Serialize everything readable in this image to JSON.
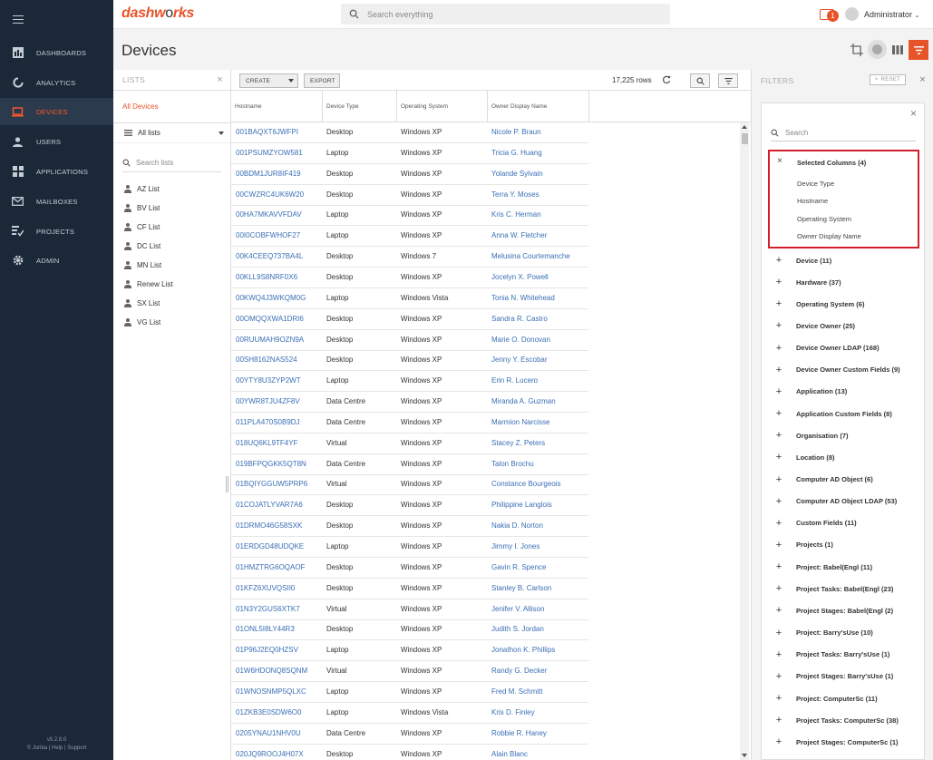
{
  "app": {
    "logo_main": "dashw",
    "logo_o": "o",
    "logo_rest": "rks"
  },
  "search": {
    "placeholder": "Search everything"
  },
  "notifications": {
    "count": "1"
  },
  "user": {
    "name": "Administrator"
  },
  "nav": {
    "items": [
      {
        "label": "DASHBOARDS",
        "icon": "dashboard-icon"
      },
      {
        "label": "ANALYTICS",
        "icon": "analytics-icon"
      },
      {
        "label": "DEVICES",
        "icon": "laptop-icon",
        "active": true
      },
      {
        "label": "USERS",
        "icon": "user-icon"
      },
      {
        "label": "APPLICATIONS",
        "icon": "applications-icon"
      },
      {
        "label": "MAILBOXES",
        "icon": "mail-icon"
      },
      {
        "label": "PROJECTS",
        "icon": "projects-icon"
      },
      {
        "label": "ADMIN",
        "icon": "gear-icon"
      }
    ],
    "version": "v5.2.8.0",
    "footer": "© Juriba | Help | Support"
  },
  "page": {
    "title": "Devices"
  },
  "lists": {
    "title": "LISTS",
    "all_devices": "All Devices",
    "all_lists": "All lists",
    "search_placeholder": "Search lists",
    "items": [
      "AZ List",
      "BV List",
      "CF List",
      "DC List",
      "MN List",
      "Renew List",
      "SX List",
      "VG List"
    ]
  },
  "grid": {
    "create_label": "CREATE",
    "export_label": "EXPORT",
    "rows_count": "17,225 rows",
    "columns": [
      "Hostname",
      "Device Type",
      "Operating System",
      "Owner Display Name"
    ],
    "rows": [
      [
        "001BAQXT6JWFPI",
        "Desktop",
        "Windows XP",
        "Nicole P. Braun"
      ],
      [
        "001PSUMZYOW581",
        "Laptop",
        "Windows XP",
        "Tricia G. Huang"
      ],
      [
        "00BDM1JUR8IF419",
        "Desktop",
        "Windows XP",
        "Yolande Sylvain"
      ],
      [
        "00CWZRC4UK6W20",
        "Desktop",
        "Windows XP",
        "Terra Y. Moses"
      ],
      [
        "00HA7MKAVVFDAV",
        "Laptop",
        "Windows XP",
        "Kris C. Herman"
      ],
      [
        "00I0COBFWHOF27",
        "Laptop",
        "Windows XP",
        "Anna W. Fletcher"
      ],
      [
        "00K4CEEQ737BA4L",
        "Desktop",
        "Windows 7",
        "Melusina Courtemanche"
      ],
      [
        "00KLL9S8NRF0X6",
        "Desktop",
        "Windows XP",
        "Jocelyn X. Powell"
      ],
      [
        "00KWQ4J3WKQM0G",
        "Laptop",
        "Windows Vista",
        "Tonia N. Whitehead"
      ],
      [
        "00OMQQXWA1DRI6",
        "Desktop",
        "Windows XP",
        "Sandra R. Castro"
      ],
      [
        "00RUUMAH9OZN9A",
        "Desktop",
        "Windows XP",
        "Marie O. Donovan"
      ],
      [
        "00SH8162NAS524",
        "Desktop",
        "Windows XP",
        "Jenny Y. Escobar"
      ],
      [
        "00YTY8U3ZYP2WT",
        "Laptop",
        "Windows XP",
        "Erin R. Lucero"
      ],
      [
        "00YWR8TJU4ZF8V",
        "Data Centre",
        "Windows XP",
        "Miranda A. Guzman"
      ],
      [
        "011PLA470S0B9DJ",
        "Data Centre",
        "Windows XP",
        "Marmion Narcisse"
      ],
      [
        "018UQ6KL9TF4YF",
        "Virtual",
        "Windows XP",
        "Stacey Z. Peters"
      ],
      [
        "019BFPQGKK5QT8N",
        "Data Centre",
        "Windows XP",
        "Talon Brochu"
      ],
      [
        "01BQIYGGUW5PRP6",
        "Virtual",
        "Windows XP",
        "Constance Bourgeois"
      ],
      [
        "01COJATLYVAR7A6",
        "Desktop",
        "Windows XP",
        "Philippine Langlois"
      ],
      [
        "01DRMO46G58SXK",
        "Desktop",
        "Windows XP",
        "Nakia D. Norton"
      ],
      [
        "01ERDGD48UDQKE",
        "Laptop",
        "Windows XP",
        "Jimmy I. Jones"
      ],
      [
        "01HMZTRG6OQAOF",
        "Desktop",
        "Windows XP",
        "Gavin R. Spence"
      ],
      [
        "01KFZ6XUVQSII0",
        "Desktop",
        "Windows XP",
        "Stanley B. Carlson"
      ],
      [
        "01N3Y2GUS6XTK7",
        "Virtual",
        "Windows XP",
        "Jenifer V. Allison"
      ],
      [
        "01ONL5I8LY44R3",
        "Desktop",
        "Windows XP",
        "Judith S. Jordan"
      ],
      [
        "01P96J2EQ0HZSV",
        "Laptop",
        "Windows XP",
        "Jonathon K. Phillips"
      ],
      [
        "01W6HDONQ8SQNM",
        "Virtual",
        "Windows XP",
        "Randy G. Decker"
      ],
      [
        "01WNOSNMP5QLXC",
        "Laptop",
        "Windows XP",
        "Fred M. Schmitt"
      ],
      [
        "01ZKB3E0SDW6O0",
        "Laptop",
        "Windows Vista",
        "Kris D. Finley"
      ],
      [
        "0205YNAU1NHV0U",
        "Data Centre",
        "Windows XP",
        "Robbie R. Haney"
      ],
      [
        "020JQ9ROOJ4H07X",
        "Desktop",
        "Windows XP",
        "Alain Blanc"
      ]
    ]
  },
  "filters": {
    "title": "FILTERS",
    "reset_label": "RESET",
    "search_placeholder": "Search",
    "selected_title": "Selected Columns (4)",
    "selected_items": [
      "Device Type",
      "Hostname",
      "Operating System",
      "Owner Display Name"
    ],
    "categories": [
      "Device (11)",
      "Hardware (37)",
      "Operating System (6)",
      "Device Owner (25)",
      "Device Owner LDAP (168)",
      "Device Owner Custom Fields (9)",
      "Application (13)",
      "Application Custom Fields (8)",
      "Organisation (7)",
      "Location (8)",
      "Computer AD Object (6)",
      "Computer AD Object LDAP (53)",
      "Custom Fields (11)",
      "Projects (1)",
      "Project: Babel(Engl (11)",
      "Project Tasks: Babel(Engl (23)",
      "Project Stages: Babel(Engl (2)",
      "Project: Barry'sUse (10)",
      "Project Tasks: Barry'sUse (1)",
      "Project Stages: Barry'sUse (1)",
      "Project: ComputerSc (11)",
      "Project Tasks: ComputerSc (38)",
      "Project Stages: ComputerSc (1)"
    ]
  },
  "colors": {
    "accent": "#e8542a",
    "nav_bg": "#1b2838",
    "link": "#3a6fb5",
    "highlight_border": "#d21f2e"
  }
}
